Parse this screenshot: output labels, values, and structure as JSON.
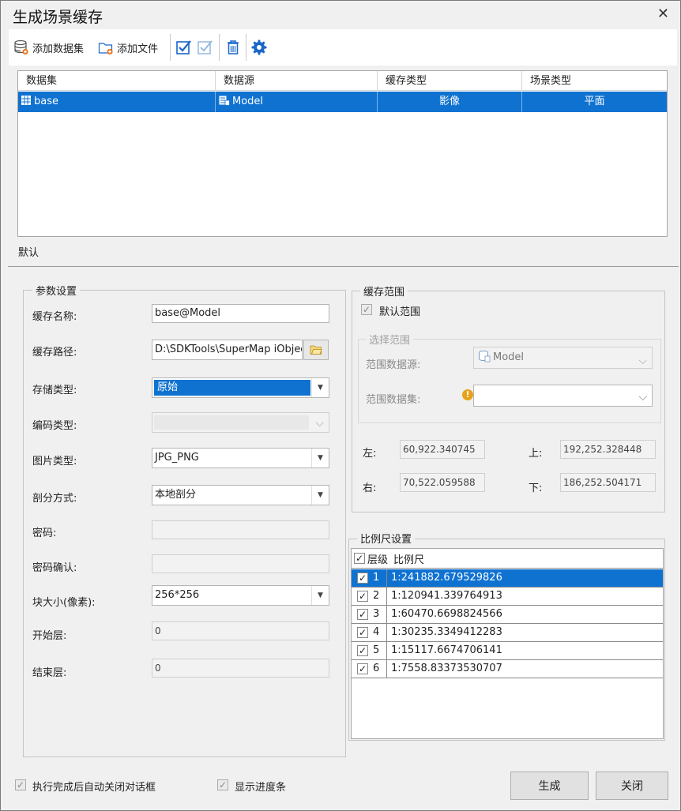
{
  "window": {
    "title": "生成场景缓存",
    "close_glyph": "✕"
  },
  "toolbar": {
    "add_dataset_label": "添加数据集",
    "add_file_label": "添加文件"
  },
  "grid": {
    "columns": [
      "数据集",
      "数据源",
      "缓存类型",
      "场景类型"
    ],
    "rows": [
      {
        "dataset": "base",
        "datasource": "Model",
        "cache_type": "影像",
        "scene_type": "平面"
      }
    ]
  },
  "tab": {
    "label": "默认"
  },
  "params": {
    "group_title": "参数设置",
    "cache_name_label": "缓存名称:",
    "cache_name_value": "base@Model",
    "cache_path_label": "缓存路径:",
    "cache_path_value": "D:\\SDKTools\\SuperMap iObjec",
    "storage_type_label": "存储类型:",
    "storage_type_value": "原始",
    "encoding_type_label": "编码类型:",
    "encoding_type_value": "",
    "image_type_label": "图片类型:",
    "image_type_value": "JPG_PNG",
    "tiling_label": "剖分方式:",
    "tiling_value": "本地剖分",
    "password_label": "密码:",
    "password_value": "",
    "password_confirm_label": "密码确认:",
    "password_confirm_value": "",
    "tile_size_label": "块大小(像素):",
    "tile_size_value": "256*256",
    "start_level_label": "开始层:",
    "start_level_value": "0",
    "end_level_label": "结束层:",
    "end_level_value": "0"
  },
  "range": {
    "group_title": "缓存范围",
    "default_range_label": "默认范围",
    "default_range_checked": true,
    "select_group_title": "选择范围",
    "range_datasource_label": "范围数据源:",
    "range_datasource_value": "Model",
    "range_dataset_label": "范围数据集:",
    "range_dataset_value": "",
    "left_label": "左:",
    "left_value": "60,922.340745",
    "top_label": "上:",
    "top_value": "192,252.328448",
    "right_label": "右:",
    "right_value": "70,522.059588",
    "bottom_label": "下:",
    "bottom_value": "186,252.504171"
  },
  "scales": {
    "group_title": "比例尺设置",
    "col_level": "层级",
    "col_scale": "比例尺",
    "rows": [
      {
        "level": "1",
        "scale": "1:241882.679529826",
        "checked": true
      },
      {
        "level": "2",
        "scale": "1:120941.339764913",
        "checked": true
      },
      {
        "level": "3",
        "scale": "1:60470.6698824566",
        "checked": true
      },
      {
        "level": "4",
        "scale": "1:30235.3349412283",
        "checked": true
      },
      {
        "level": "5",
        "scale": "1:15117.6674706141",
        "checked": true
      },
      {
        "level": "6",
        "scale": "1:7558.83373530707",
        "checked": true
      }
    ]
  },
  "footer": {
    "auto_close_label": "执行完成后自动关闭对话框",
    "show_progress_label": "显示进度条",
    "generate_label": "生成",
    "close_label": "关闭"
  },
  "colors": {
    "selection": "#0f72d1",
    "accent_blue": "#1a66c9"
  }
}
